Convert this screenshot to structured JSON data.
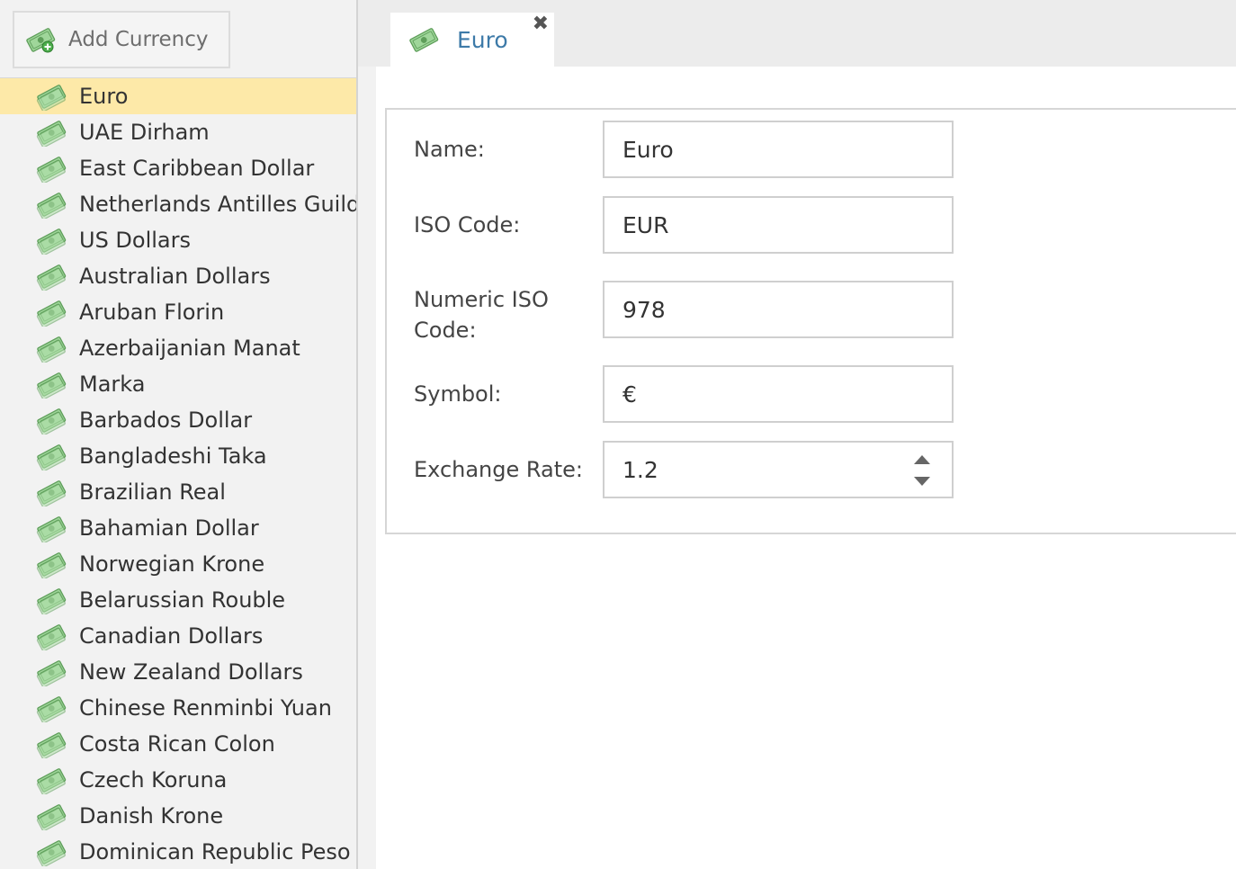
{
  "sidebar": {
    "add_button_label": "Add Currency",
    "items": [
      {
        "name": "Euro",
        "selected": true
      },
      {
        "name": "UAE Dirham"
      },
      {
        "name": "East Caribbean Dollar"
      },
      {
        "name": "Netherlands Antilles Guild"
      },
      {
        "name": "US Dollars"
      },
      {
        "name": "Australian Dollars"
      },
      {
        "name": "Aruban Florin"
      },
      {
        "name": "Azerbaijanian Manat"
      },
      {
        "name": "Marka"
      },
      {
        "name": "Barbados Dollar"
      },
      {
        "name": "Bangladeshi Taka"
      },
      {
        "name": "Brazilian Real"
      },
      {
        "name": "Bahamian Dollar"
      },
      {
        "name": "Norwegian Krone"
      },
      {
        "name": "Belarussian Rouble"
      },
      {
        "name": "Canadian Dollars"
      },
      {
        "name": "New Zealand Dollars"
      },
      {
        "name": "Chinese Renminbi Yuan"
      },
      {
        "name": "Costa Rican Colon"
      },
      {
        "name": "Czech Koruna"
      },
      {
        "name": "Danish Krone"
      },
      {
        "name": "Dominican Republic Peso"
      }
    ]
  },
  "tab": {
    "label": "Euro",
    "close_glyph": "✖"
  },
  "form": {
    "name_label": "Name:",
    "name_value": "Euro",
    "iso_label": "ISO Code:",
    "iso_value": "EUR",
    "numeric_iso_label_line1": "Numeric ISO",
    "numeric_iso_label_line2": "Code:",
    "numeric_iso_value": "978",
    "symbol_label": "Symbol:",
    "symbol_value": "€",
    "exchange_label": "Exchange Rate:",
    "exchange_value": "1.2"
  },
  "colors": {
    "selected_row": "#fde9a8",
    "tab_text": "#3d7aa8",
    "money_green": "#7fc47a"
  },
  "icons": {
    "currency": "money-bill-icon",
    "add": "money-bill-add-icon",
    "close": "close-icon",
    "spinner_up": "caret-up-icon",
    "spinner_down": "caret-down-icon"
  }
}
